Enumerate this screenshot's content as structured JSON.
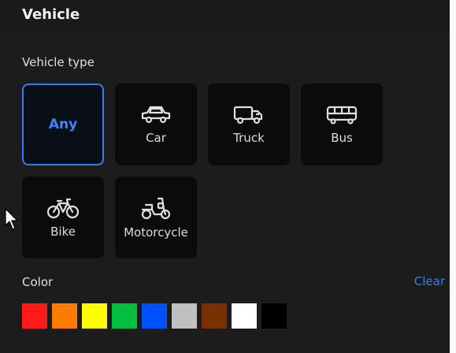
{
  "header": {
    "title": "Vehicle"
  },
  "vehicle_type": {
    "label": "Vehicle type",
    "options": [
      {
        "label": "Any",
        "icon": "",
        "selected": true
      },
      {
        "label": "Car",
        "icon": "car-icon",
        "selected": false
      },
      {
        "label": "Truck",
        "icon": "truck-icon",
        "selected": false
      },
      {
        "label": "Bus",
        "icon": "bus-icon",
        "selected": false
      },
      {
        "label": "Bike",
        "icon": "bike-icon",
        "selected": false
      },
      {
        "label": "Motorcycle",
        "icon": "motorcycle-icon",
        "selected": false
      }
    ]
  },
  "color": {
    "label": "Color",
    "clear_label": "Clear",
    "swatches": [
      "#ff1a1a",
      "#ff7a00",
      "#ffff00",
      "#00c040",
      "#0050ff",
      "#c0c0c0",
      "#7a3000",
      "#ffffff",
      "#000000"
    ]
  },
  "theme": {
    "accent": "#2f7df0",
    "background": "#1c1c1c",
    "tile": "#0b0b0b"
  }
}
